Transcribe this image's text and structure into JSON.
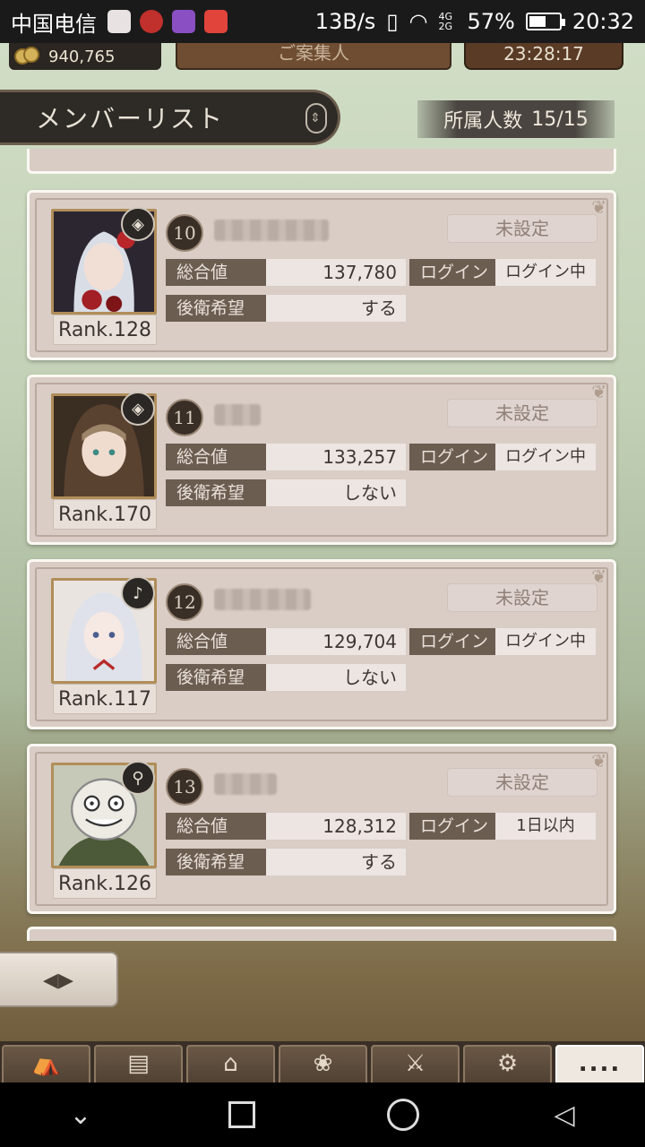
{
  "status_bar": {
    "carrier": "中国电信",
    "speed": "13B/s",
    "network": "4G 2G",
    "battery": "57%",
    "battery_level": 0.57,
    "time": "20:32"
  },
  "top": {
    "coins": "940,765",
    "middle_tab": "ご案集人",
    "timer": "23:28:17"
  },
  "header": {
    "title": "メンバーリスト",
    "member_count_label": "所属人数",
    "member_count": "15/15"
  },
  "members": [
    {
      "num": "10",
      "rank": "Rank.128",
      "unset": "未設定",
      "total_label": "総合値",
      "total": "137,780",
      "login_label": "ログイン",
      "login": "ログイン中",
      "rear_label": "後衛希望",
      "rear": "する",
      "job_icon": "shield-icon"
    },
    {
      "num": "11",
      "rank": "Rank.170",
      "unset": "未設定",
      "total_label": "総合値",
      "total": "133,257",
      "login_label": "ログイン",
      "login": "ログイン中",
      "rear_label": "後衛希望",
      "rear": "しない",
      "job_icon": "shield-icon"
    },
    {
      "num": "12",
      "rank": "Rank.117",
      "unset": "未設定",
      "total_label": "総合値",
      "total": "129,704",
      "login_label": "ログイン",
      "login": "ログイン中",
      "rear_label": "後衛希望",
      "rear": "しない",
      "job_icon": "harp-icon"
    },
    {
      "num": "13",
      "rank": "Rank.126",
      "unset": "未設定",
      "total_label": "総合値",
      "total": "128,312",
      "login_label": "ログイン",
      "login": "1日以内",
      "rear_label": "後衛希望",
      "rear": "する",
      "job_icon": "staff-icon"
    }
  ],
  "menu": {
    "items": [
      "camp-icon",
      "book-icon",
      "story-icon",
      "gacha-icon",
      "weapon-icon",
      "gear-icon"
    ],
    "more_label": "...."
  }
}
